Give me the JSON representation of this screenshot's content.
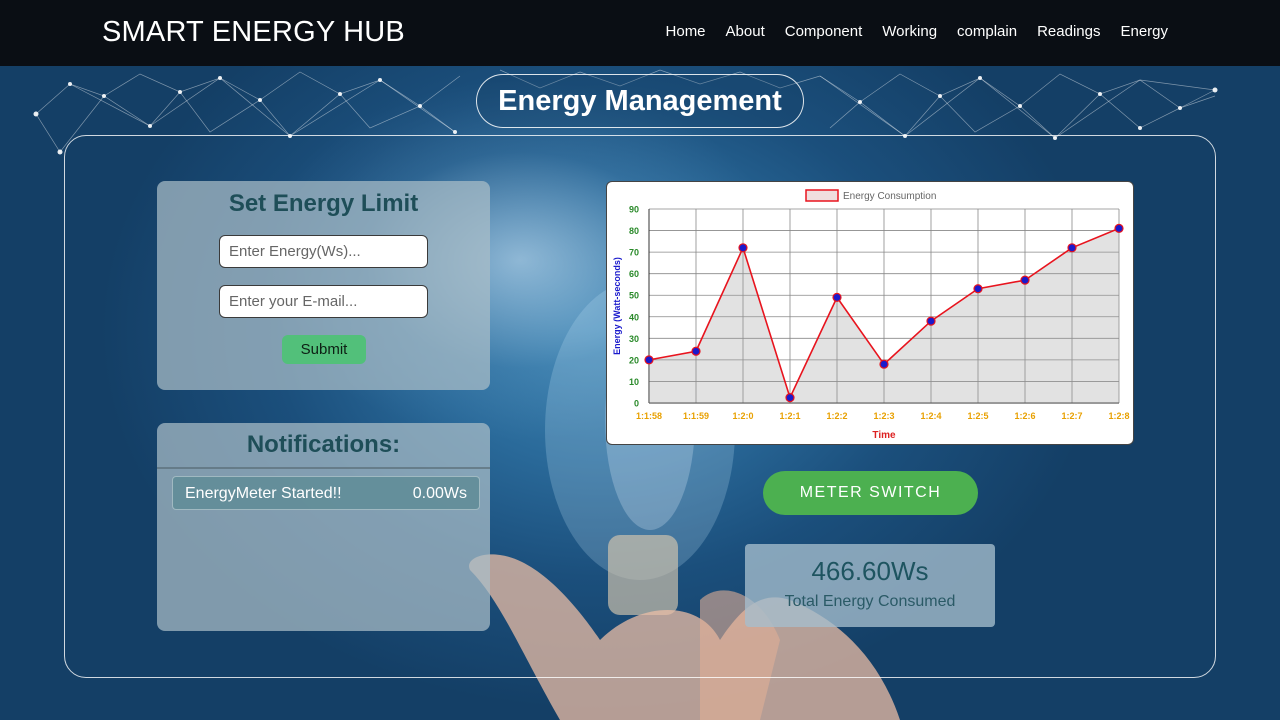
{
  "nav": {
    "brand": "SMART ENERGY HUB",
    "links": [
      "Home",
      "About",
      "Component",
      "Working",
      "complain",
      "Readings",
      "Energy"
    ]
  },
  "page": {
    "title": "Energy Management"
  },
  "limit_panel": {
    "title": "Set Energy Limit",
    "energy_placeholder": "Enter Energy(Ws)...",
    "email_placeholder": "Enter your E-mail...",
    "submit_label": "Submit"
  },
  "notifications": {
    "title": "Notifications:",
    "items": [
      {
        "message": "EnergyMeter Started!!",
        "value": "0.00Ws"
      }
    ]
  },
  "meter": {
    "switch_label": "METER SWITCH",
    "total_value": "466.60Ws",
    "total_label": "Total Energy Consumed"
  },
  "colors": {
    "navbar_bg": "#0a0e14",
    "panel_title": "#1e4e58",
    "submit_bg": "#52c07a",
    "switch_bg": "#4cb050",
    "line": "#e8141e",
    "point_fill": "#1a1acc",
    "tick_x": "#e8a000",
    "tick_y": "#2a8a2a",
    "ylabel": "#1a1acc",
    "xlabel": "#dd2222"
  },
  "chart_data": {
    "type": "area",
    "categories": [
      "1:1:58",
      "1:1:59",
      "1:2:0",
      "1:2:1",
      "1:2:2",
      "1:2:3",
      "1:2:4",
      "1:2:5",
      "1:2:6",
      "1:2:7",
      "1:2:8"
    ],
    "series": [
      {
        "name": "Energy Consumption",
        "values": [
          20,
          24,
          72,
          2.5,
          49,
          18,
          38,
          53,
          57,
          72,
          81
        ]
      }
    ],
    "xlabel": "Time",
    "ylabel": "Energy (Watt-seconds)",
    "ylim": [
      0,
      90
    ],
    "yticks": [
      0,
      10,
      20,
      30,
      40,
      50,
      60,
      70,
      80,
      90
    ],
    "grid": true,
    "legend": "top-center"
  }
}
